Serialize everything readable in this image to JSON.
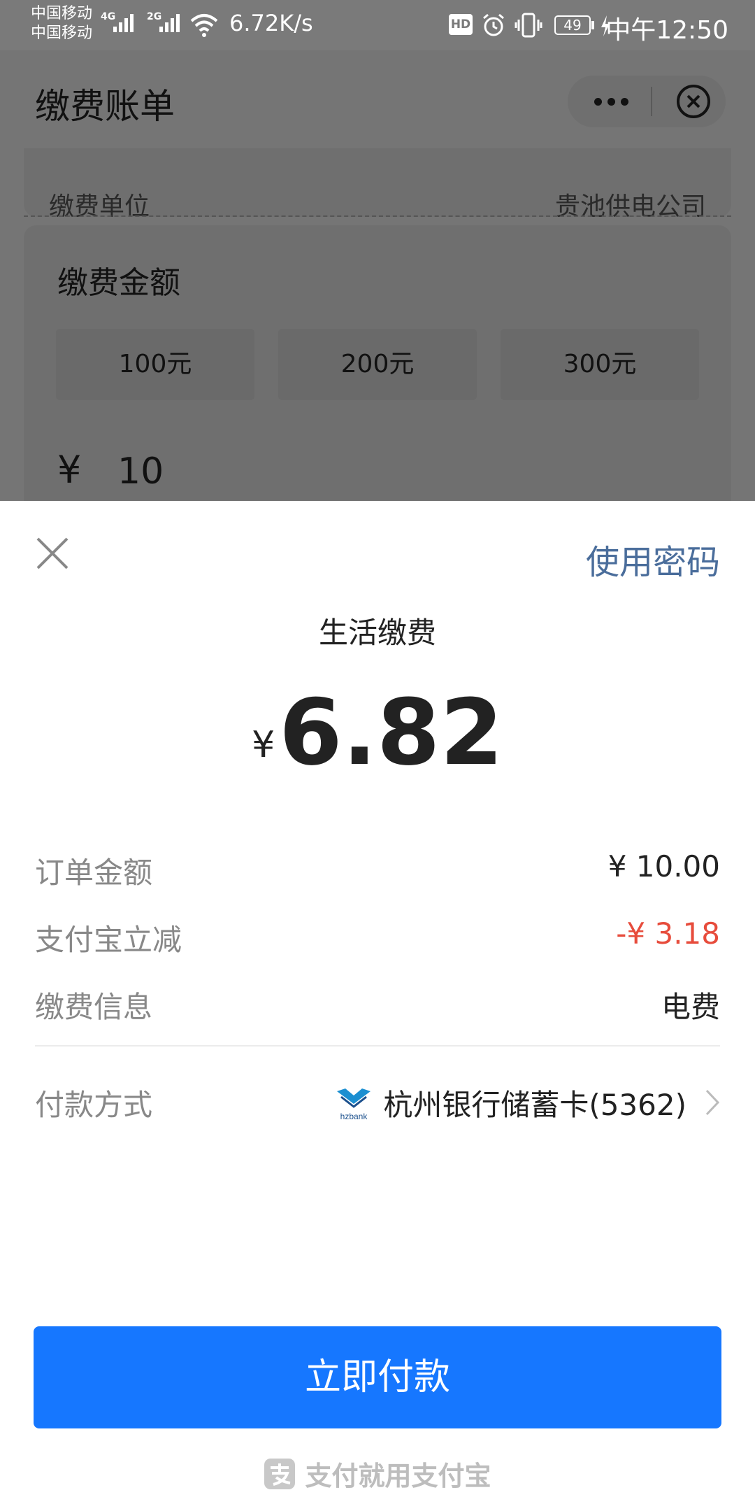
{
  "status_bar": {
    "carrier1": "中国移动",
    "carrier2": "中国移动",
    "sig1_type": "4G",
    "sig2_type": "2G",
    "net_speed": "6.72K/s",
    "hd_badge": "HD",
    "battery": "49",
    "time": "中午12:50"
  },
  "nav": {
    "title": "缴费账单"
  },
  "background_form": {
    "unit_label": "缴费单位",
    "unit_value": "贵池供电公司",
    "amount_title": "缴费金额",
    "options": [
      "100元",
      "200元",
      "300元"
    ],
    "currency": "¥",
    "entered_amount": "10"
  },
  "sheet": {
    "use_password": "使用密码",
    "subject": "生活缴费",
    "currency": "¥",
    "amount": "6.82",
    "rows": [
      {
        "label": "订单金额",
        "value": "¥ 10.00"
      },
      {
        "label": "支付宝立减",
        "value": "-¥ 3.18"
      },
      {
        "label": "缴费信息",
        "value": "电费"
      }
    ],
    "payment_method_label": "付款方式",
    "bank_logo_text": "hzbank",
    "bank_name": "杭州银行储蓄卡(5362)",
    "pay_button": "立即付款",
    "footer_slogan": "支付就用支付宝"
  },
  "colors": {
    "primary_blue": "#1677ff",
    "link_blue": "#4a6d9b",
    "discount_red": "#e74c3c"
  },
  "icons": {
    "close": "close-icon",
    "more": "more-icon",
    "chevron": "chevron-right-icon",
    "alipay": "alipay-icon"
  }
}
